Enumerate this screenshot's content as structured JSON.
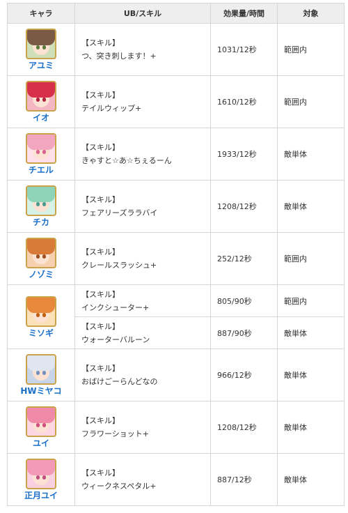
{
  "headers": {
    "character": "キャラ",
    "skill": "UB/スキル",
    "amount": "効果量/時間",
    "target": "対象"
  },
  "rows": [
    {
      "name": "アユミ",
      "portrait": {
        "hair": "#7a5a45",
        "bg": "#cfe0b8",
        "eye": "#5a7a3a"
      },
      "skills": [
        {
          "label": "【スキル】",
          "skill_name": "つ、突き刺します！+",
          "amount": "1031/12秒",
          "target": "範囲内"
        }
      ]
    },
    {
      "name": "イオ",
      "portrait": {
        "hair": "#d8304a",
        "bg": "#f3b6c2",
        "eye": "#b02040"
      },
      "skills": [
        {
          "label": "【スキル】",
          "skill_name": "テイルウィップ+",
          "amount": "1610/12秒",
          "target": "範囲内"
        }
      ]
    },
    {
      "name": "チエル",
      "portrait": {
        "hair": "#f2a6c0",
        "bg": "#fde0ea",
        "eye": "#d96090"
      },
      "skills": [
        {
          "label": "【スキル】",
          "skill_name": "きゃすと☆あ☆ちぇるーん",
          "amount": "1933/12秒",
          "target": "敵単体"
        }
      ]
    },
    {
      "name": "チカ",
      "portrait": {
        "hair": "#8ed4b8",
        "bg": "#d6f2e6",
        "eye": "#4a9a90"
      },
      "skills": [
        {
          "label": "【スキル】",
          "skill_name": "フェアリーズララバイ",
          "amount": "1208/12秒",
          "target": "敵単体"
        }
      ]
    },
    {
      "name": "ノゾミ",
      "portrait": {
        "hair": "#d87a3a",
        "bg": "#f7d0b0",
        "eye": "#a05020"
      },
      "skills": [
        {
          "label": "【スキル】",
          "skill_name": "クレールスラッシュ+",
          "amount": "252/12秒",
          "target": "範囲内"
        }
      ]
    },
    {
      "name": "ミソギ",
      "portrait": {
        "hair": "#e8883a",
        "bg": "#fbe0b8",
        "eye": "#c06010"
      },
      "skills": [
        {
          "label": "【スキル】",
          "skill_name": "インクシューター+",
          "amount": "805/90秒",
          "target": "範囲内"
        },
        {
          "label": "【スキル】",
          "skill_name": "ウォーターバルーン",
          "amount": "887/90秒",
          "target": "敵単体"
        }
      ]
    },
    {
      "name": "HWミヤコ",
      "portrait": {
        "hair": "#dfe6ef",
        "bg": "#c8d4e8",
        "eye": "#7090c0"
      },
      "skills": [
        {
          "label": "【スキル】",
          "skill_name": "おばけごーらんどなの",
          "amount": "966/12秒",
          "target": "敵単体"
        }
      ]
    },
    {
      "name": "ユイ",
      "portrait": {
        "hair": "#f08aa8",
        "bg": "#fcd6e2",
        "eye": "#d05080"
      },
      "skills": [
        {
          "label": "【スキル】",
          "skill_name": "フラワーショット+",
          "amount": "1208/12秒",
          "target": "敵単体"
        }
      ]
    },
    {
      "name": "正月ユイ",
      "portrait": {
        "hair": "#f29ab8",
        "bg": "#f8d0e0",
        "eye": "#c05080"
      },
      "skills": [
        {
          "label": "【スキル】",
          "skill_name": "ウィークネスペタル+",
          "amount": "887/12秒",
          "target": "敵単体"
        }
      ]
    }
  ]
}
